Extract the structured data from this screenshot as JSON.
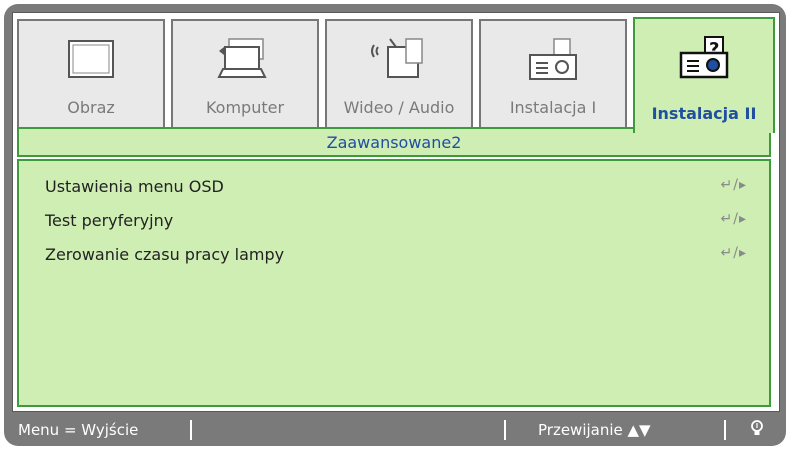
{
  "tabs": [
    {
      "label": "Obraz",
      "icon": "monitor-icon"
    },
    {
      "label": "Komputer",
      "icon": "laptop-icon"
    },
    {
      "label": "Wideo / Audio",
      "icon": "tv-antenna-icon"
    },
    {
      "label": "Instalacja I",
      "icon": "projector-icon"
    },
    {
      "label": "Instalacja II",
      "icon": "projector-help-icon"
    }
  ],
  "active_tab": "Instalacja II",
  "section_title": "Zaawansowane2",
  "menu_items": [
    {
      "label": "Ustawienia menu OSD",
      "action": "↵/▸"
    },
    {
      "label": "Test peryferyjny",
      "action": "↵/▸"
    },
    {
      "label": "Zerowanie czasu pracy lampy",
      "action": "↵/▸"
    }
  ],
  "footer": {
    "exit_hint": "Menu = Wyjście",
    "scroll_hint": "Przewijanie ▲▼",
    "lamp_icon": "lightbulb-icon"
  },
  "colors": {
    "accent_green": "#3d9a3d",
    "panel_bg": "#cfeeb4",
    "active_text": "#1f4fa0",
    "frame": "#7a7a7a"
  }
}
